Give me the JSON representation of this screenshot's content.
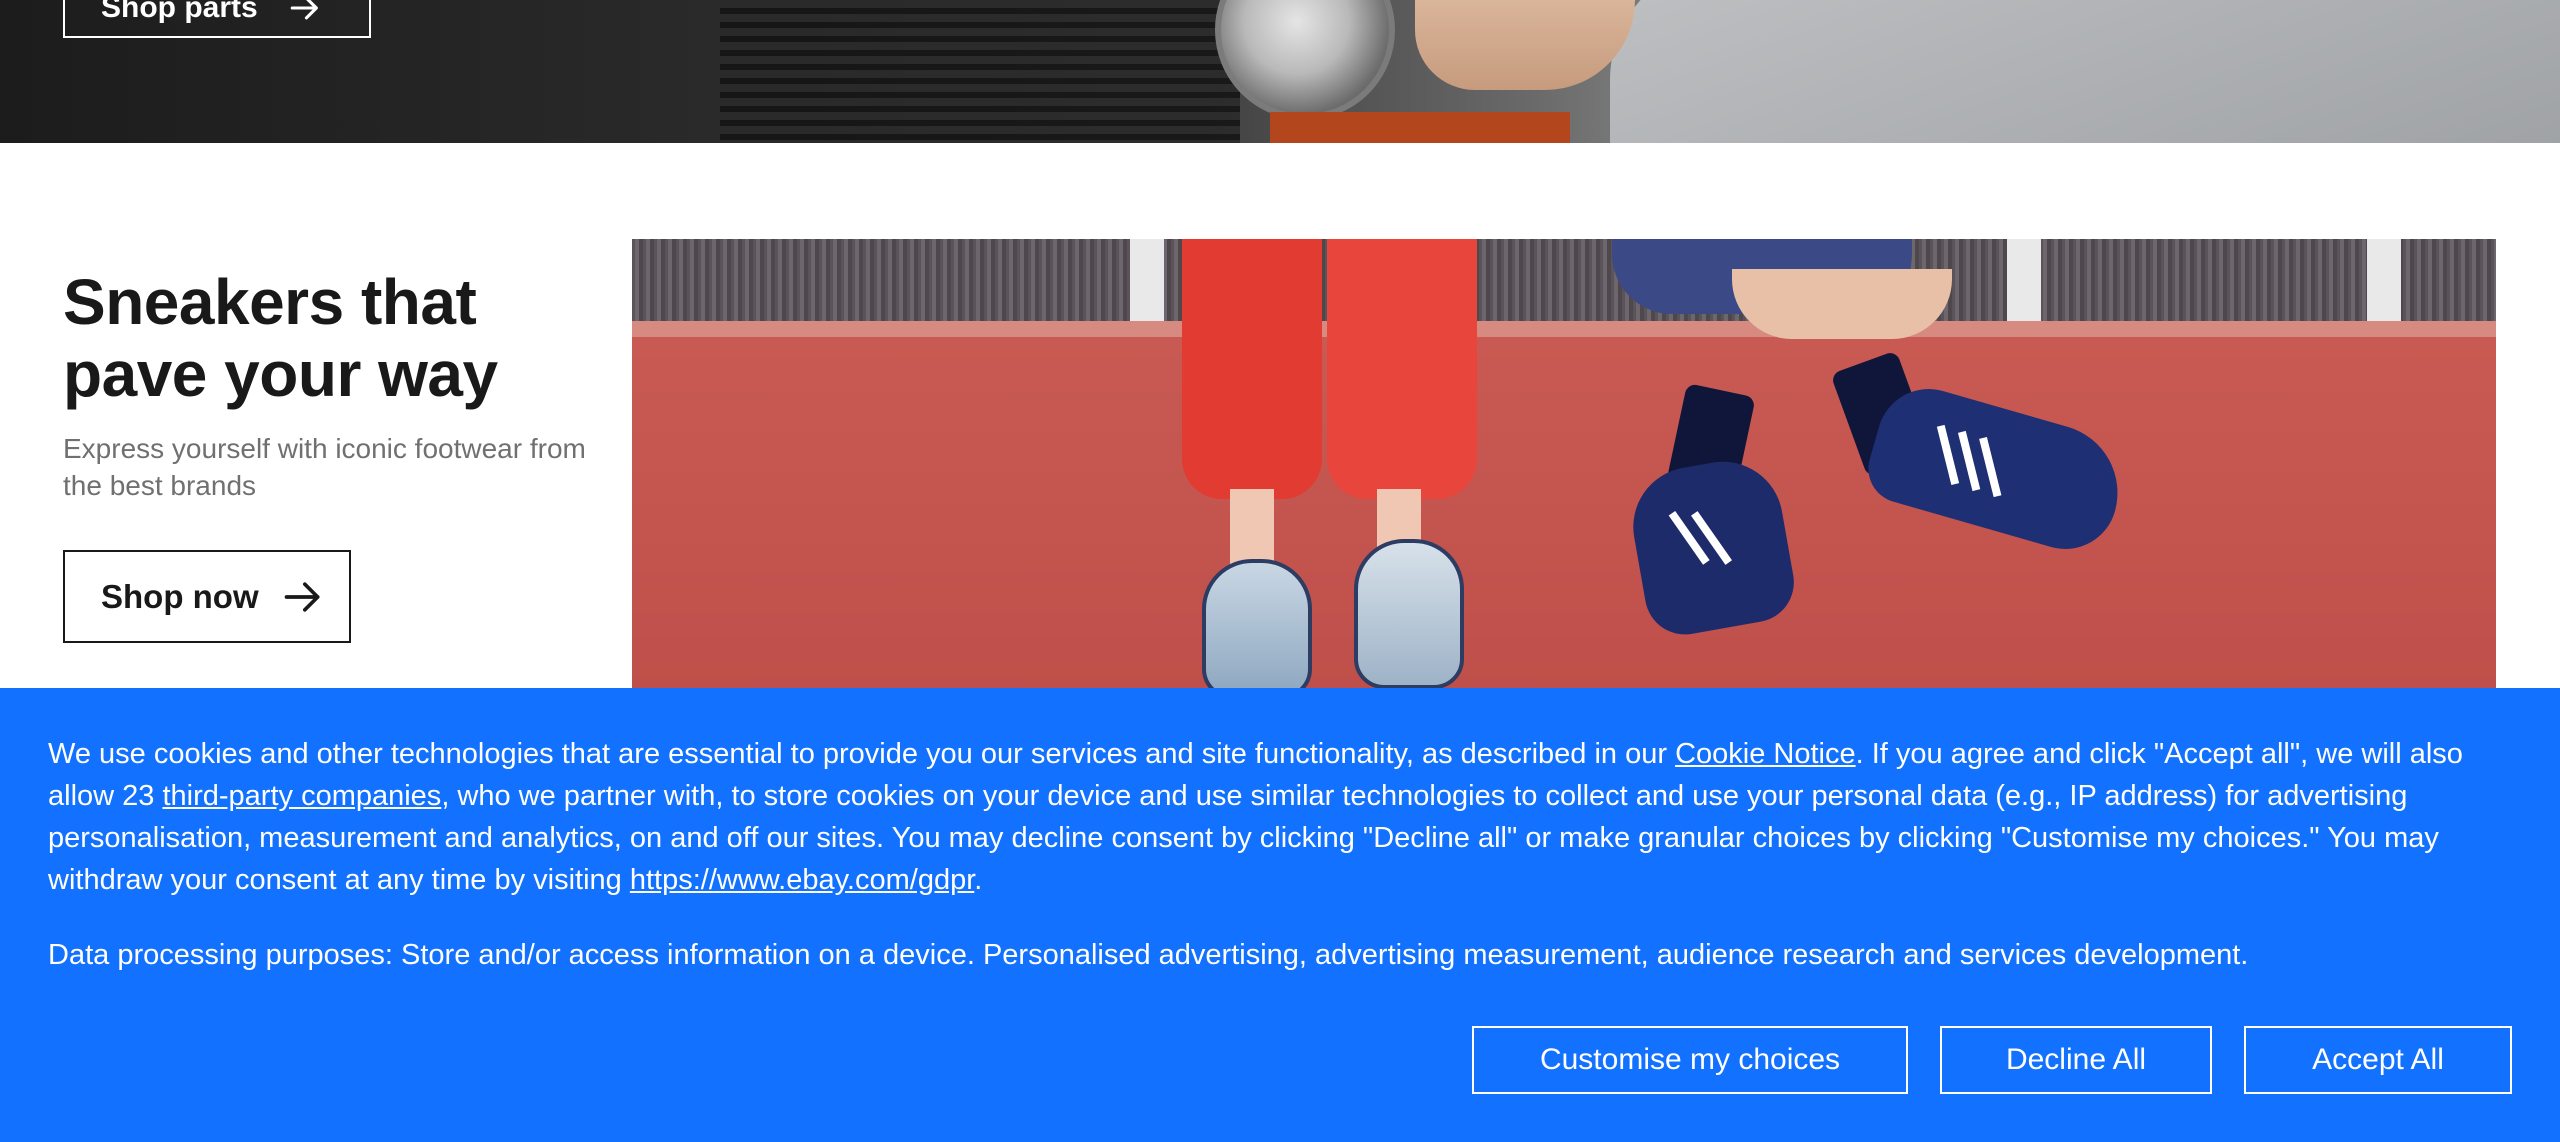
{
  "hero_top": {
    "button_label": "Shop parts"
  },
  "promo": {
    "headline": "Sneakers that pave your way",
    "subtext": "Express yourself with iconic footwear from the best brands",
    "button_label": "Shop now"
  },
  "cookie_banner": {
    "text_part1": "We use cookies and other technologies that are essential to provide you our services and site functionality, as described in our ",
    "cookie_notice_link": "Cookie Notice",
    "text_part2": ". If you agree and click \"Accept all\", we will also allow 23 ",
    "third_party_link": "third-party companies",
    "text_part3": ", who we partner with, to store cookies on your device and use similar technologies to collect and use your personal data (e.g., IP address) for advertising personalisation, measurement and analytics, on and off our sites. You may decline consent by clicking \"Decline all\" or make granular choices by clicking \"Customise my choices.\" You may withdraw your consent at any time by visiting ",
    "gdpr_link": "https://www.ebay.com/gdpr",
    "text_part4": ".",
    "purposes": "Data processing purposes: Store and/or access information on a device. Personalised advertising, advertising measurement, audience research and services development.",
    "customise_label": "Customise my choices",
    "decline_label": "Decline All",
    "accept_label": "Accept All",
    "background_color": "#1271ff"
  },
  "icons": {
    "arrow": "arrow-right-icon"
  }
}
